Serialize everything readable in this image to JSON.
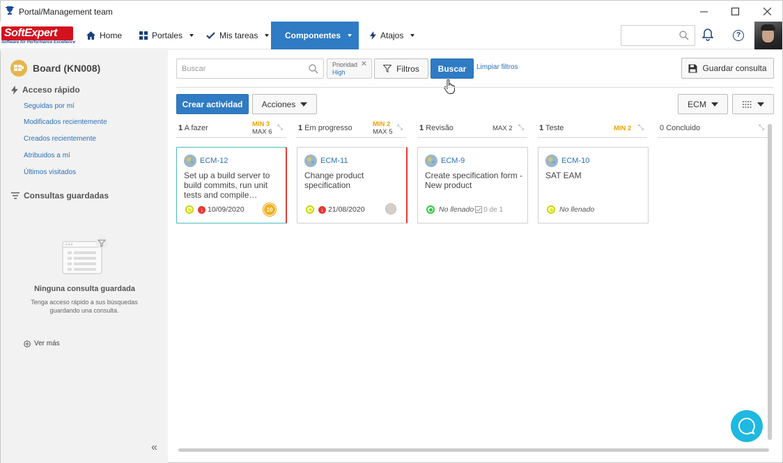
{
  "window": {
    "title": "Portal/Management team",
    "controls": [
      "minimize",
      "maximize",
      "close"
    ]
  },
  "navbar": {
    "logo_brand": "SoftExpert",
    "logo_tagline": "Software for Performance Excellence",
    "items": [
      {
        "label": "Home",
        "icon": "home-icon",
        "has_caret": false,
        "active": false
      },
      {
        "label": "Portales",
        "icon": "grid-icon",
        "has_caret": true,
        "active": false
      },
      {
        "label": "Mis tareas",
        "icon": "check-icon",
        "has_caret": true,
        "active": false
      },
      {
        "label": "Componentes",
        "icon": "trophy-icon",
        "has_caret": true,
        "active": true
      },
      {
        "label": "Atajos",
        "icon": "bolt-icon",
        "has_caret": true,
        "active": false
      }
    ],
    "search_placeholder": ""
  },
  "sidebar": {
    "board_title": "Board (KN008)",
    "quick_access_title": "Acceso rápido",
    "quick_links": [
      "Seguidas por mí",
      "Modificados recientemente",
      "Creados recientemente",
      "Atribuidos a mí",
      "Últimos visitados"
    ],
    "saved_queries_title": "Consultas guardadas",
    "empty_title": "Ninguna consulta guardada",
    "empty_subtitle": "Tenga acceso rápido a sus búsquedas guardando una consulta.",
    "see_more": "Ver más"
  },
  "toolbar": {
    "search_placeholder": "Buscar",
    "chip_key": "Prioridad",
    "chip_value": "High",
    "filters_label": "Filtros",
    "search_button": "Buscar",
    "clear_filters": "Limpiar filtros",
    "save_query": "Guardar consulta",
    "create_activity": "Crear actividad",
    "actions": "Acciones",
    "ecm_select": "ECM"
  },
  "columns": [
    {
      "count": "1",
      "name": "A fazer",
      "min": "MIN 3",
      "max": "MAX 6"
    },
    {
      "count": "1",
      "name": "Em progresso",
      "min": "MIN 2",
      "max": "MAX 5"
    },
    {
      "count": "1",
      "name": "Revisão",
      "min": "",
      "max": "MAX 2"
    },
    {
      "count": "1",
      "name": "Teste",
      "min": "MIN 2",
      "max": ""
    },
    {
      "count": "0",
      "name": "Concluido",
      "min": "",
      "max": ""
    }
  ],
  "cards": [
    {
      "id": "ECM-12",
      "title": "Set up a build server to build commits, run unit tests and compile…",
      "status_color": "yellow",
      "date": "10/09/2020",
      "badge": "10",
      "state": "",
      "progress": "",
      "flag_color": "#e53935"
    },
    {
      "id": "ECM-11",
      "title": "Change product specification",
      "status_color": "yellow",
      "date": "21/08/2020",
      "badge": "",
      "state": "",
      "progress": "",
      "flag_color": "#e53935"
    },
    {
      "id": "ECM-9",
      "title": "Create specification form - New product",
      "status_color": "green",
      "date": "",
      "badge": "",
      "state": "No llenado",
      "progress": "0 de 1",
      "flag_color": ""
    },
    {
      "id": "ECM-10",
      "title": "SAT EAM",
      "status_color": "yellow",
      "date": "",
      "badge": "",
      "state": "No llenado",
      "progress": "",
      "flag_color": ""
    }
  ],
  "colors": {
    "accent": "#2f7bc4",
    "min_limit": "#e8a500",
    "overdue": "#e53935",
    "chat": "#1fb8e0"
  }
}
